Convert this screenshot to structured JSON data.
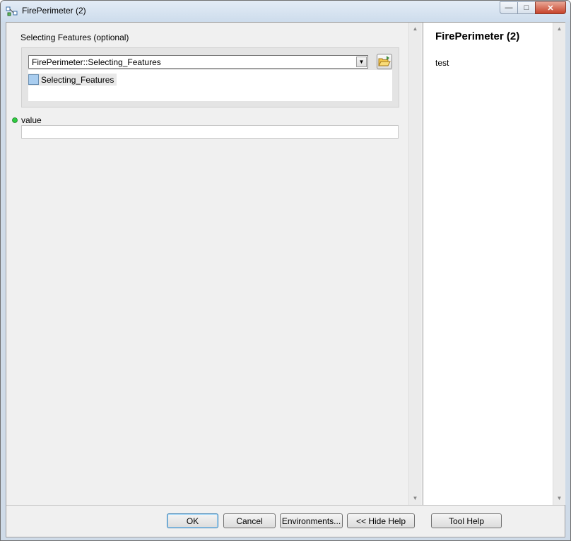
{
  "window": {
    "title": "FirePerimeter (2)",
    "controls": {
      "minimize": "—",
      "maximize": "□",
      "close": "✕"
    }
  },
  "parameters": {
    "selecting_features": {
      "label": "Selecting Features (optional)",
      "combo_value": "FirePerimeter::Selecting_Features",
      "list_items": [
        "Selecting_Features"
      ]
    },
    "value": {
      "label": "value",
      "input_value": ""
    }
  },
  "help": {
    "title": "FirePerimeter (2)",
    "body": "test"
  },
  "buttons": {
    "ok": "OK",
    "cancel": "Cancel",
    "environments": "Environments...",
    "hide_help": "<< Hide Help",
    "tool_help": "Tool Help"
  },
  "colors": {
    "required_dot": "#2ecc40",
    "feature_swatch": "#a9cdef"
  }
}
